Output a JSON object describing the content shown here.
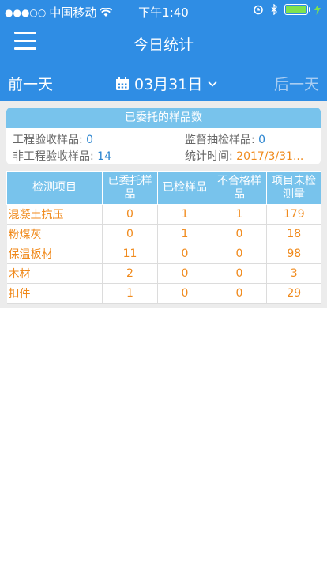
{
  "status_bar": {
    "carrier": "中国移动",
    "time": "下午1:40"
  },
  "nav": {
    "title": "今日统计",
    "menu_icon": "hamburger-menu-icon"
  },
  "date_bar": {
    "prev_label": "前一天",
    "date": "03月31日",
    "next_label": "后一天"
  },
  "summary": {
    "title": "已委托的样品数",
    "engineering_label": "工程验收样品:",
    "engineering_value": "0",
    "supervision_label": "监督抽检样品:",
    "supervision_value": "0",
    "non_engineering_label": "非工程验收样品:",
    "non_engineering_value": "14",
    "stat_time_label": "统计时间:",
    "stat_time_value": "2017/3/31..."
  },
  "table": {
    "headers": [
      "检测项目",
      "已委托样品",
      "已检样品",
      "不合格样品",
      "项目未检测量"
    ],
    "rows": [
      [
        "混凝土抗压",
        "0",
        "1",
        "1",
        "179"
      ],
      [
        "粉煤灰",
        "0",
        "1",
        "0",
        "18"
      ],
      [
        "保温板材",
        "11",
        "0",
        "0",
        "98"
      ],
      [
        "木材",
        "2",
        "0",
        "0",
        "3"
      ],
      [
        "扣件",
        "1",
        "0",
        "0",
        "29"
      ]
    ]
  },
  "colors": {
    "primary": "#2f8de4",
    "header_cell": "#78c3ec",
    "value_orange": "#f08a1c",
    "value_blue": "#2a84cf"
  }
}
